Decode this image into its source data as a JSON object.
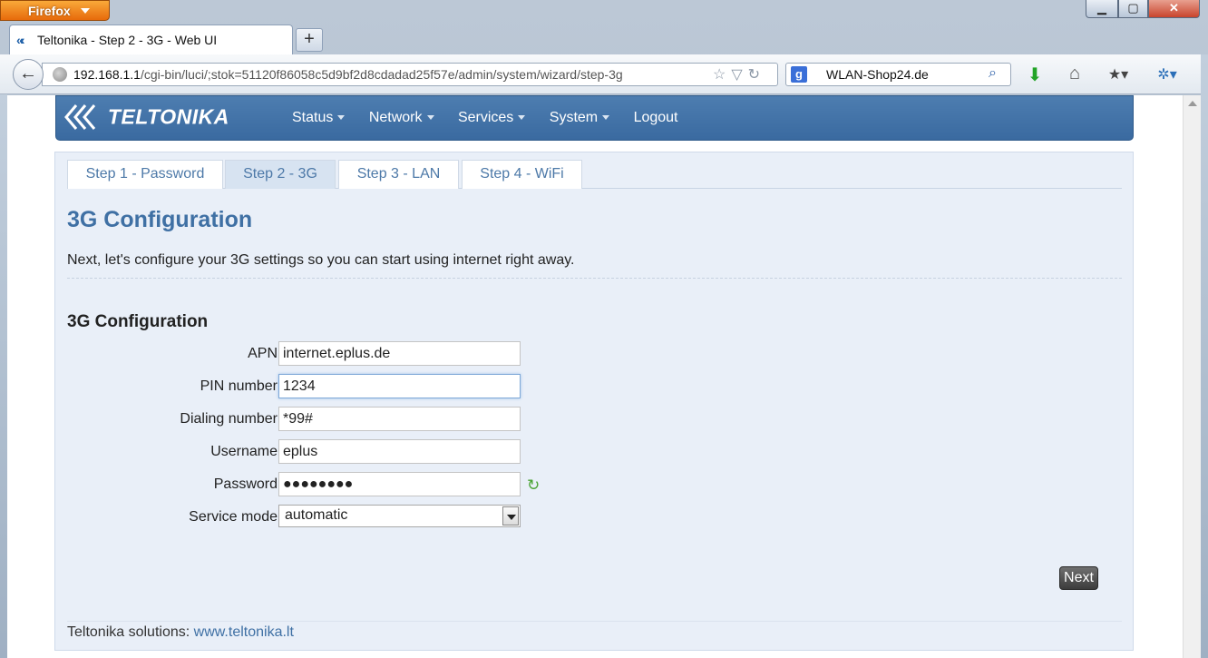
{
  "browser": {
    "menu_button": "Firefox",
    "tab_title": "Teltonika - Step 2 - 3G - Web UI",
    "new_tab": "+",
    "url_host": "192.168.1.1",
    "url_path": "/cgi-bin/luci/;stok=51120f86058c5d9bf2d8cdadad25f57e/admin/system/wizard/step-3g",
    "search_value": "WLAN-Shop24.de"
  },
  "header": {
    "logo": "TELTONIKA",
    "menu": [
      "Status",
      "Network",
      "Services",
      "System",
      "Logout"
    ]
  },
  "wizard": {
    "tabs": [
      "Step 1 - Password",
      "Step 2 - 3G",
      "Step 3 - LAN",
      "Step 4 - WiFi"
    ],
    "active_tab": 1,
    "title": "3G Configuration",
    "intro": "Next, let's configure your 3G settings so you can start using internet right away.",
    "section_title": "3G Configuration",
    "fields": {
      "apn": {
        "label": "APN",
        "value": "internet.eplus.de"
      },
      "pin": {
        "label": "PIN number",
        "value": "1234"
      },
      "dial": {
        "label": "Dialing number",
        "value": "*99#"
      },
      "username": {
        "label": "Username",
        "value": "eplus"
      },
      "password": {
        "label": "Password",
        "value": "●●●●●●●●"
      },
      "service_mode": {
        "label": "Service mode",
        "value": "automatic"
      }
    },
    "next_label": "Next"
  },
  "footer": {
    "text": "Teltonika solutions: ",
    "link": "www.teltonika.lt"
  },
  "colors": {
    "header_blue": "#3f6fa3",
    "panel_bg": "#e9eff8",
    "title_blue": "#3f70a4",
    "firefox_orange": "#e76a0b"
  }
}
